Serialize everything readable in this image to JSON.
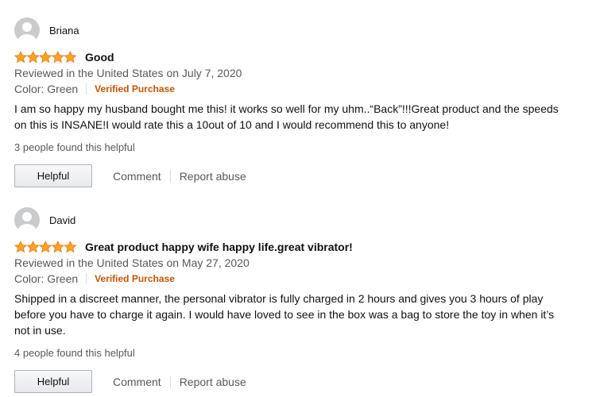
{
  "reviews": [
    {
      "reviewer": "Briana",
      "rating": 5,
      "title": "Good",
      "reviewed_line": "Reviewed in the United States on July 7, 2020",
      "color": "Color: Green",
      "verified": "Verified Purchase",
      "body": "I am so happy my husband bought me this! it works so well for my uhm..“Back”!!!Great product and the speeds on this is INSANE!I would rate this a 10out of 10 and I would recommend this to anyone!",
      "helpful_count": "3 people found this helpful",
      "helpful_label": "Helpful",
      "comment_label": "Comment",
      "report_label": "Report abuse"
    },
    {
      "reviewer": "David",
      "rating": 5,
      "title": "Great product happy wife happy life.great vibrator!",
      "reviewed_line": "Reviewed in the United States on May 27, 2020",
      "color": "Color: Green",
      "verified": "Verified Purchase",
      "body": "Shipped in a discreet manner, the personal vibrator is fully charged in 2 hours and gives you 3 hours of play before you have to charge it again. I would have loved to see in the box was a bag to store the toy in when it’s not in use.",
      "helpful_count": "4 people found this helpful",
      "helpful_label": "Helpful",
      "comment_label": "Comment",
      "report_label": "Report abuse"
    }
  ],
  "icons": {
    "avatar": "default-avatar-icon",
    "star": "star-icon"
  },
  "colors": {
    "star_fill": "#ffa41c",
    "star_stroke": "#de7921",
    "verified": "#c45500",
    "secondary_text": "#565959"
  }
}
